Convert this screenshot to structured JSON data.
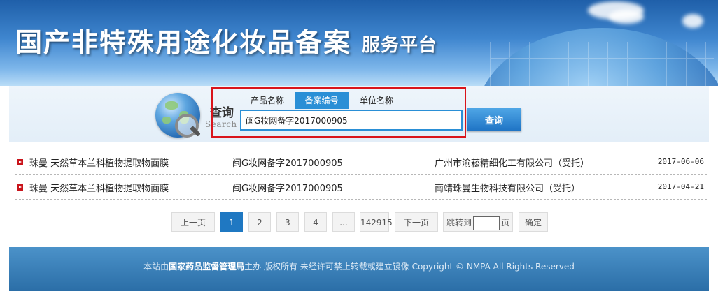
{
  "banner": {
    "title": "国产非特殊用途化妆品备案",
    "subtitle": "服务平台"
  },
  "search": {
    "label_cn": "查询",
    "label_en": "Search",
    "tabs": [
      {
        "label": "产品名称",
        "active": false
      },
      {
        "label": "备案编号",
        "active": true
      },
      {
        "label": "单位名称",
        "active": false
      }
    ],
    "input_value": "闽G妆网备字2017000905",
    "button_label": "查询",
    "accent_color": "#2a8fd6",
    "highlight_color": "#d9141b"
  },
  "results": [
    {
      "product": "珠曼 天然草本兰科植物提取物面膜",
      "code": "闽G妆网备字2017000905",
      "company": "广州市渝菘精细化工有限公司（受托）",
      "date": "2017-06-06"
    },
    {
      "product": "珠曼 天然草本兰科植物提取物面膜",
      "code": "闽G妆网备字2017000905",
      "company": "南靖珠曼生物科技有限公司（受托）",
      "date": "2017-04-21"
    }
  ],
  "pagination": {
    "prev": "上一页",
    "pages": [
      "1",
      "2",
      "3",
      "4"
    ],
    "current": "1",
    "ellipsis": "...",
    "last": "142915",
    "next": "下一页",
    "jump_label": "跳转到",
    "page_unit": "页",
    "confirm": "确定"
  },
  "footer": {
    "prefix": "本站由",
    "org": "国家药品监督管理局",
    "suffix": "主办 版权所有 未经许可禁止转载或建立镜像 Copyright © NMPA All Rights Reserved"
  }
}
